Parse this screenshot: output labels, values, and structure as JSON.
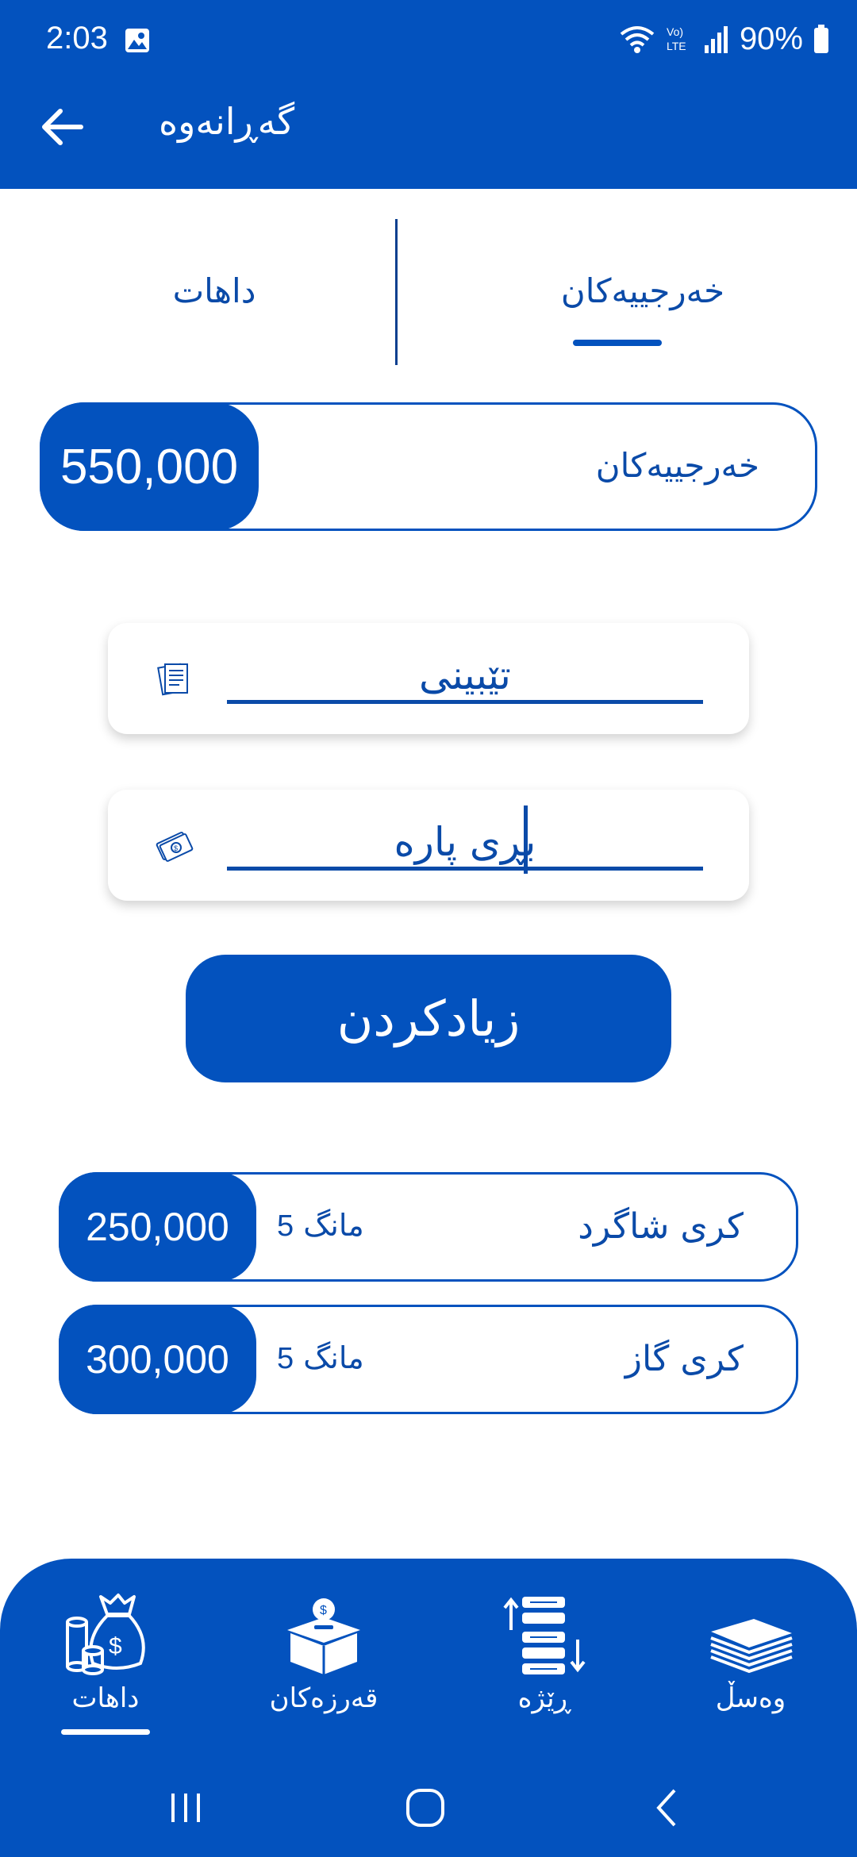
{
  "status_bar": {
    "time": "2:03",
    "battery": "90%"
  },
  "app_bar": {
    "title": "گەڕانەوە"
  },
  "tabs": [
    {
      "label": "داهات",
      "active": false
    },
    {
      "label": "خەرجییەکان",
      "active": true
    }
  ],
  "total": {
    "label": "خەرجییەکان",
    "amount": "550,000"
  },
  "form": {
    "note_value": "تێبینی",
    "amount_value": "بڕی پارە",
    "submit_label": "زیادکردن"
  },
  "expenses": [
    {
      "title": "کری شاگرد",
      "month_word": "مانگ",
      "month_num": "5",
      "amount": "250,000"
    },
    {
      "title": "کری گاز",
      "month_word": "مانگ",
      "month_num": "5",
      "amount": "300,000"
    }
  ],
  "bottom_nav": {
    "items": [
      {
        "label": "داهات",
        "icon": "money-bag-icon",
        "active": true
      },
      {
        "label": "قەرزەکان",
        "icon": "donation-box-icon",
        "active": false
      },
      {
        "label": "ڕێژە",
        "icon": "sort-list-icon",
        "active": false
      },
      {
        "label": "وەسڵ",
        "icon": "paper-stack-icon",
        "active": false
      }
    ]
  },
  "colors": {
    "primary": "#0352be",
    "text": "#0a4aa8",
    "background": "#ffffff"
  }
}
